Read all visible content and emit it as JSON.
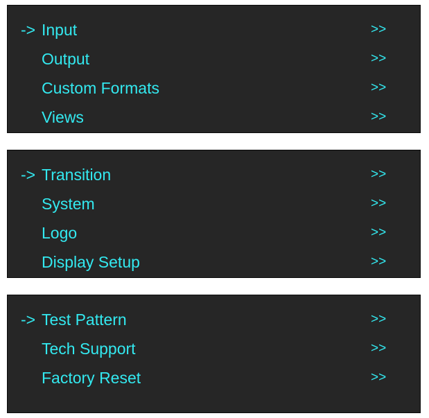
{
  "colors": {
    "panel_background": "#262626",
    "text": "#33e9f0",
    "page_background": "#ffffff"
  },
  "menus": [
    {
      "items": [
        {
          "arrow": "->",
          "label": "Input",
          "chevrons": ">>"
        },
        {
          "arrow": "",
          "label": "Output",
          "chevrons": ">>"
        },
        {
          "arrow": "",
          "label": "Custom Formats",
          "chevrons": ">>"
        },
        {
          "arrow": "",
          "label": "Views",
          "chevrons": ">>"
        }
      ]
    },
    {
      "items": [
        {
          "arrow": "->",
          "label": "Transition",
          "chevrons": ">>"
        },
        {
          "arrow": "",
          "label": "System",
          "chevrons": ">>"
        },
        {
          "arrow": "",
          "label": "Logo",
          "chevrons": ">>"
        },
        {
          "arrow": "",
          "label": "Display Setup",
          "chevrons": ">>"
        }
      ]
    },
    {
      "items": [
        {
          "arrow": "->",
          "label": "Test Pattern",
          "chevrons": ">>"
        },
        {
          "arrow": "",
          "label": "Tech Support",
          "chevrons": ">>"
        },
        {
          "arrow": "",
          "label": "Factory Reset",
          "chevrons": ">>"
        }
      ]
    }
  ]
}
